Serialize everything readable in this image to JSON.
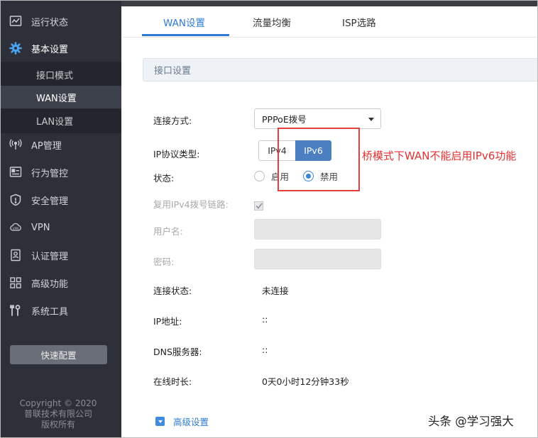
{
  "sidebar": {
    "items": [
      {
        "label": "运行状态",
        "icon": "status-chart-icon"
      },
      {
        "label": "基本设置",
        "icon": "gear-icon"
      },
      {
        "label": "AP管理",
        "icon": "antenna-icon"
      },
      {
        "label": "行为管控",
        "icon": "behavior-control-icon"
      },
      {
        "label": "安全管理",
        "icon": "shield-icon"
      },
      {
        "label": "VPN",
        "icon": "vpn-cloud-icon"
      },
      {
        "label": "认证管理",
        "icon": "auth-badge-icon"
      },
      {
        "label": "高级功能",
        "icon": "grid-icon"
      },
      {
        "label": "系统工具",
        "icon": "tools-icon"
      }
    ],
    "sub_items": [
      "接口模式",
      "WAN设置",
      "LAN设置"
    ],
    "active_sub": "WAN设置",
    "quick_config": "快速配置",
    "copyright": [
      "Copyright © 2020",
      "普联技术有限公司",
      "版权所有"
    ]
  },
  "tabs": [
    "WAN设置",
    "流量均衡",
    "ISP选路"
  ],
  "active_tab": "WAN设置",
  "section_title": "接口设置",
  "form": {
    "connection_type_label": "连接方式:",
    "connection_type_value": "PPPoE拨号",
    "ip_protocol_label": "IP协议类型:",
    "ip_protocol_options": [
      "IPv4",
      "IPv6"
    ],
    "ip_protocol_selected": "IPv6",
    "state_label": "状态:",
    "state_options": [
      "启用",
      "禁用"
    ],
    "state_selected": "禁用",
    "reuse_ipv4_label": "复用IPv4拨号链路:",
    "reuse_ipv4_checked": true,
    "username_label": "用户名:",
    "username_value": "",
    "password_label": "密码:",
    "password_value": "",
    "conn_status_label": "连接状态:",
    "conn_status_value": "未连接",
    "ip_label": "IP地址:",
    "ip_value": "::",
    "dns_label": "DNS服务器:",
    "dns_value": "::",
    "uptime_label": "在线时长:",
    "uptime_value": "0天0小时12分钟33秒",
    "advanced_label": "高级设置"
  },
  "annotation": "桥模式下WAN不能启用IPv6功能",
  "watermark": "头条 @学习强大",
  "colors": {
    "sidebar_bg": "#2d3038",
    "accent": "#2f7bd3",
    "segment_on": "#4c7fc1",
    "annotation": "#e23e3e"
  }
}
